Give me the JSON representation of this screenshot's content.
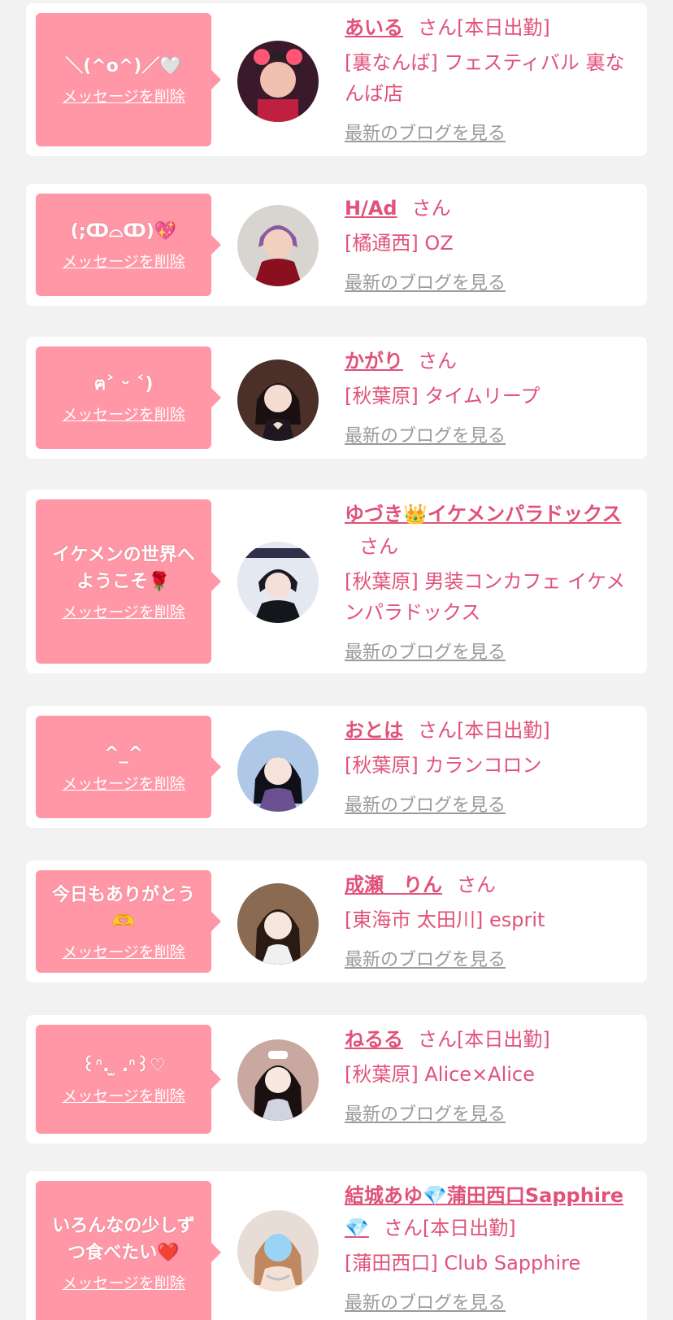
{
  "suffix": "さん",
  "delete_label": "メッセージを削除",
  "blog_label": "最新のブログを見る",
  "cards": [
    {
      "message": "＼(^o^)／🤍",
      "name": "あいる",
      "status": "[本日出勤]",
      "shop": "[裏なんば] フェスティバル 裏なんば店"
    },
    {
      "message": "(;ↀ⌓ↀ)💖",
      "name": "H/Ad",
      "status": "",
      "shop": "[橘通西] OZ"
    },
    {
      "message": "ฅ˃ ᵕ ˂)",
      "name": "かがり",
      "status": "",
      "shop": "[秋葉原] タイムリープ"
    },
    {
      "message": "イケメンの世界へようこそ🌹",
      "name": "ゆづき👑イケメンパラドックス",
      "status": "",
      "shop": "[秋葉原] 男装コンカフェ イケメンパラドックス"
    },
    {
      "message": "^_^",
      "name": "おとは",
      "status": "[本日出勤]",
      "shop": "[秋葉原] カランコロン"
    },
    {
      "message": "今日もありがとう🫶",
      "name": "成瀬　りん",
      "status": "",
      "shop": "[東海市 太田川] esprit"
    },
    {
      "message": "꒰ᐢ. ̫ .ᐢ꒱♡",
      "name": "ねるる",
      "status": "[本日出勤]",
      "shop": "[秋葉原] Alice×Alice"
    },
    {
      "message": "いろんなの少しずつ食べたい❤️",
      "name": "結城あゆ💎蒲田西口Sapphire💎",
      "status": "[本日出勤]",
      "shop": "[蒲田西口] Club Sapphire"
    }
  ],
  "colors": {
    "background": "#f2f2f2",
    "bubble": "#ff97a6",
    "accent": "#e0527a",
    "link_gray": "#9a9a9a"
  }
}
